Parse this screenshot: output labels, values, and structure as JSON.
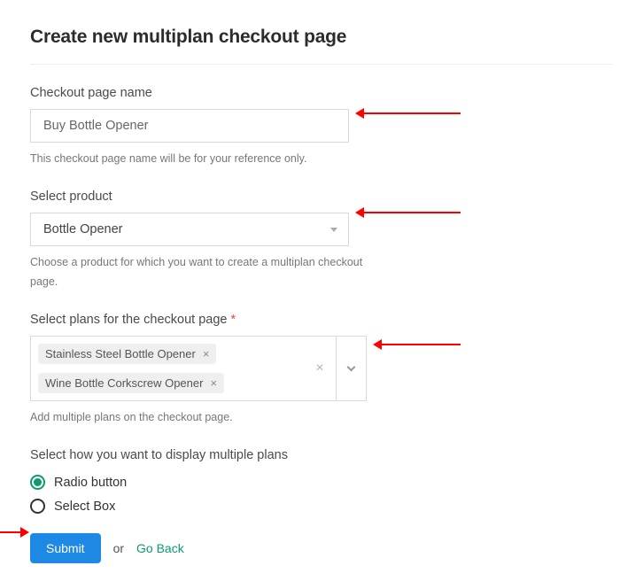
{
  "page_title": "Create new multiplan checkout page",
  "checkout_name": {
    "label": "Checkout page name",
    "value": "Buy Bottle Opener",
    "help": "This checkout page name will be for your reference only."
  },
  "product": {
    "label": "Select product",
    "selected": "Bottle Opener",
    "help": "Choose a product for which you want to create a multiplan checkout page."
  },
  "plans": {
    "label": "Select plans for the checkout page",
    "required_mark": "*",
    "tags": [
      "Stainless Steel Bottle Opener",
      "Wine Bottle Corkscrew Opener"
    ],
    "help": "Add multiple plans on the checkout page."
  },
  "display": {
    "label": "Select how you want to display multiple plans",
    "options": [
      "Radio button",
      "Select Box"
    ],
    "selected_index": 0
  },
  "actions": {
    "submit": "Submit",
    "or": "or",
    "back": "Go Back"
  }
}
